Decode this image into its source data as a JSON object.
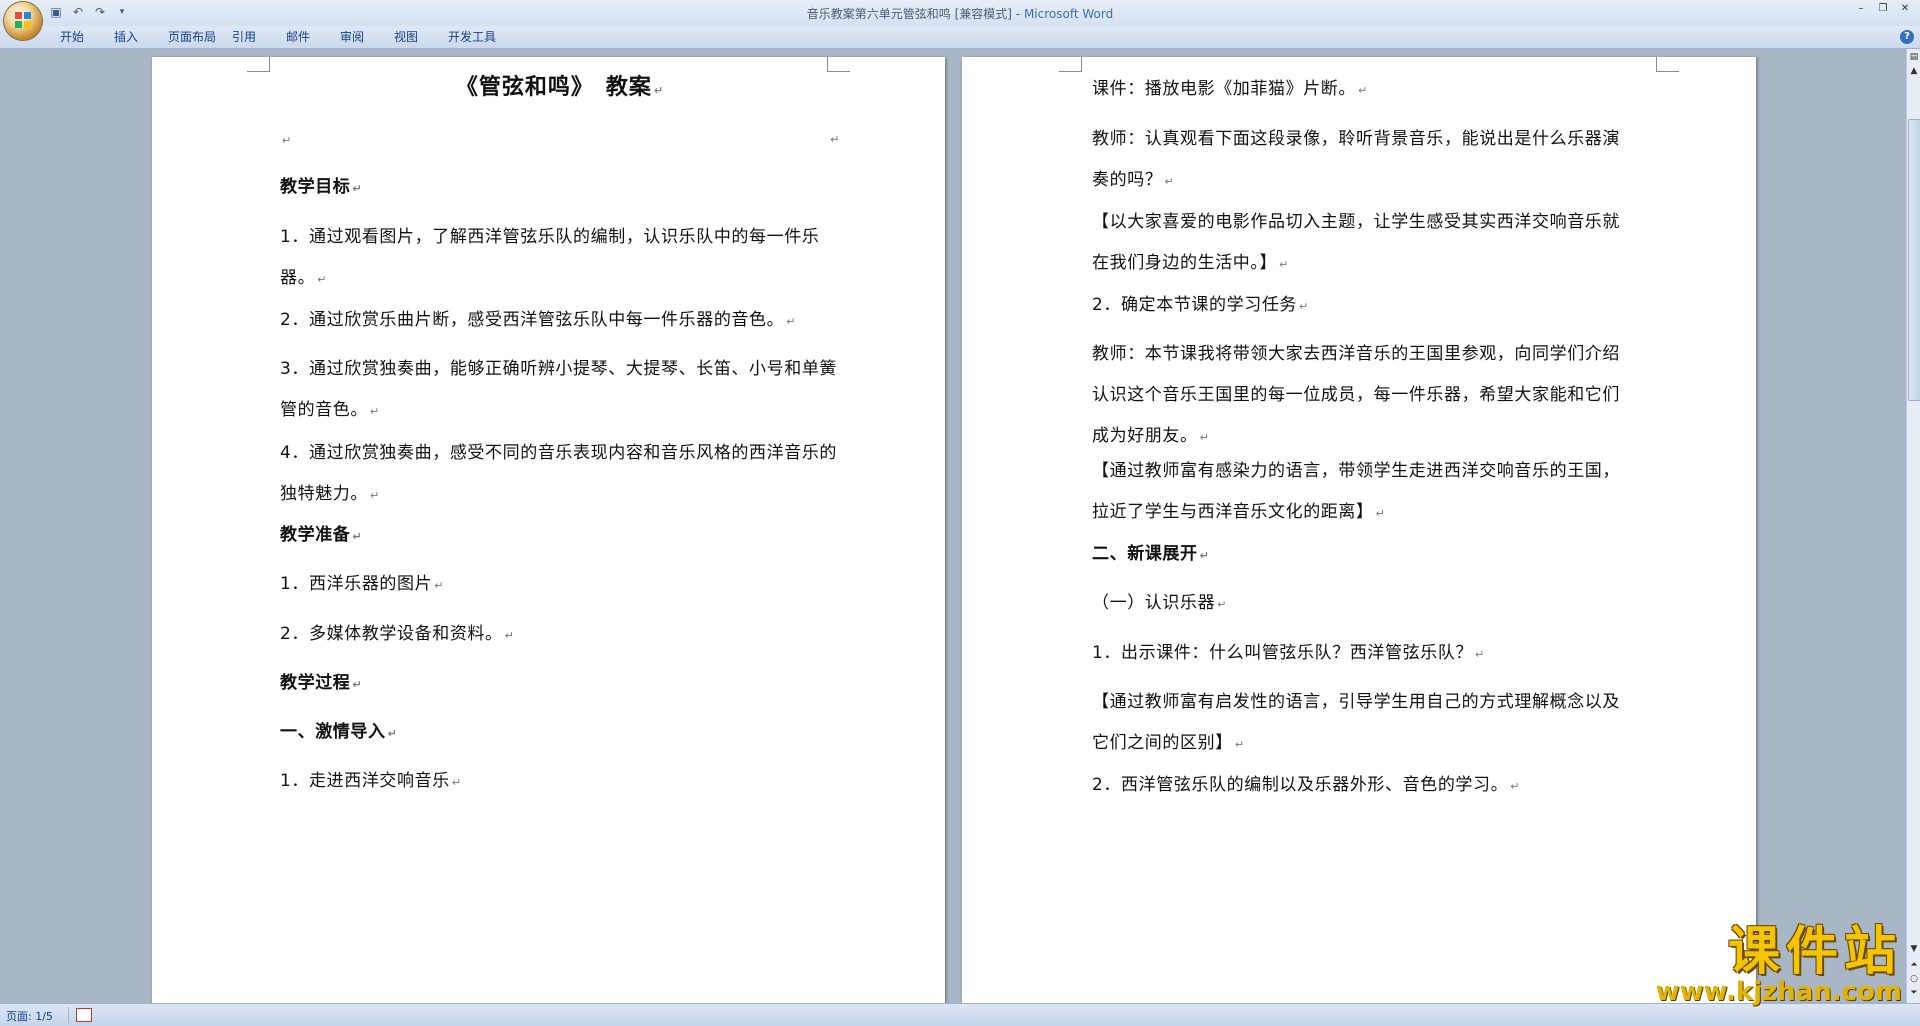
{
  "window": {
    "title": "音乐教案第六单元管弦和鸣 [兼容模式]",
    "title_sep": " - ",
    "app_name": "Microsoft Word"
  },
  "quick_access": {
    "save_icon": "save-icon",
    "undo_icon": "undo-icon",
    "redo_icon": "redo-icon",
    "customize_icon": "customize-icon"
  },
  "ribbon": {
    "tabs": [
      "开始",
      "插入",
      "页面布局",
      "引用",
      "邮件",
      "审阅",
      "视图",
      "开发工具"
    ]
  },
  "page1": {
    "title": "《管弦和鸣》　教案",
    "paragraphs": [
      "教学目标",
      "1．通过观看图片，了解西洋管弦乐队的编制，认识乐队中的每一件乐器。",
      "2．通过欣赏乐曲片断，感受西洋管弦乐队中每一件乐器的音色。",
      "3．通过欣赏独奏曲，能够正确听辨小提琴、大提琴、长笛、小号和单簧管的音色。",
      "4．通过欣赏独奏曲，感受不同的音乐表现内容和音乐风格的西洋音乐的独特魅力。",
      "教学准备",
      "1．西洋乐器的图片",
      "2．多媒体教学设备和资料。",
      "教学过程",
      "一、激情导入",
      "1．走进西洋交响音乐"
    ]
  },
  "page2": {
    "paragraphs": [
      "课件：播放电影《加菲猫》片断。",
      "教师：认真观看下面这段录像，聆听背景音乐，能说出是什么乐器演奏的吗？",
      "【以大家喜爱的电影作品切入主题，让学生感受其实西洋交响音乐就在我们身边的生活中。】",
      "2．确定本节课的学习任务",
      "教师：本节课我将带领大家去西洋音乐的王国里参观，向同学们介绍认识这个音乐王国里的每一位成员，每一件乐器，希望大家能和它们成为好朋友。",
      "【通过教师富有感染力的语言，带领学生走进西洋交响音乐的王国，拉近了学生与西洋音乐文化的距离】",
      "二、新课展开",
      "（一）认识乐器",
      "1．出示课件：什么叫管弦乐队？西洋管弦乐队？",
      "【通过教师富有启发性的语言，引导学生用自己的方式理解概念以及它们之间的区别】",
      "2．西洋管弦乐队的编制以及乐器外形、音色的学习。"
    ]
  },
  "status_bar": {
    "page_info": "页面: 1/5"
  },
  "watermark": {
    "name": "课件站",
    "url": "www.kjzhan.com"
  },
  "colors": {
    "background": "#a9b6c6",
    "ribbon_text": "#15428b",
    "watermark": "#f5c400"
  }
}
